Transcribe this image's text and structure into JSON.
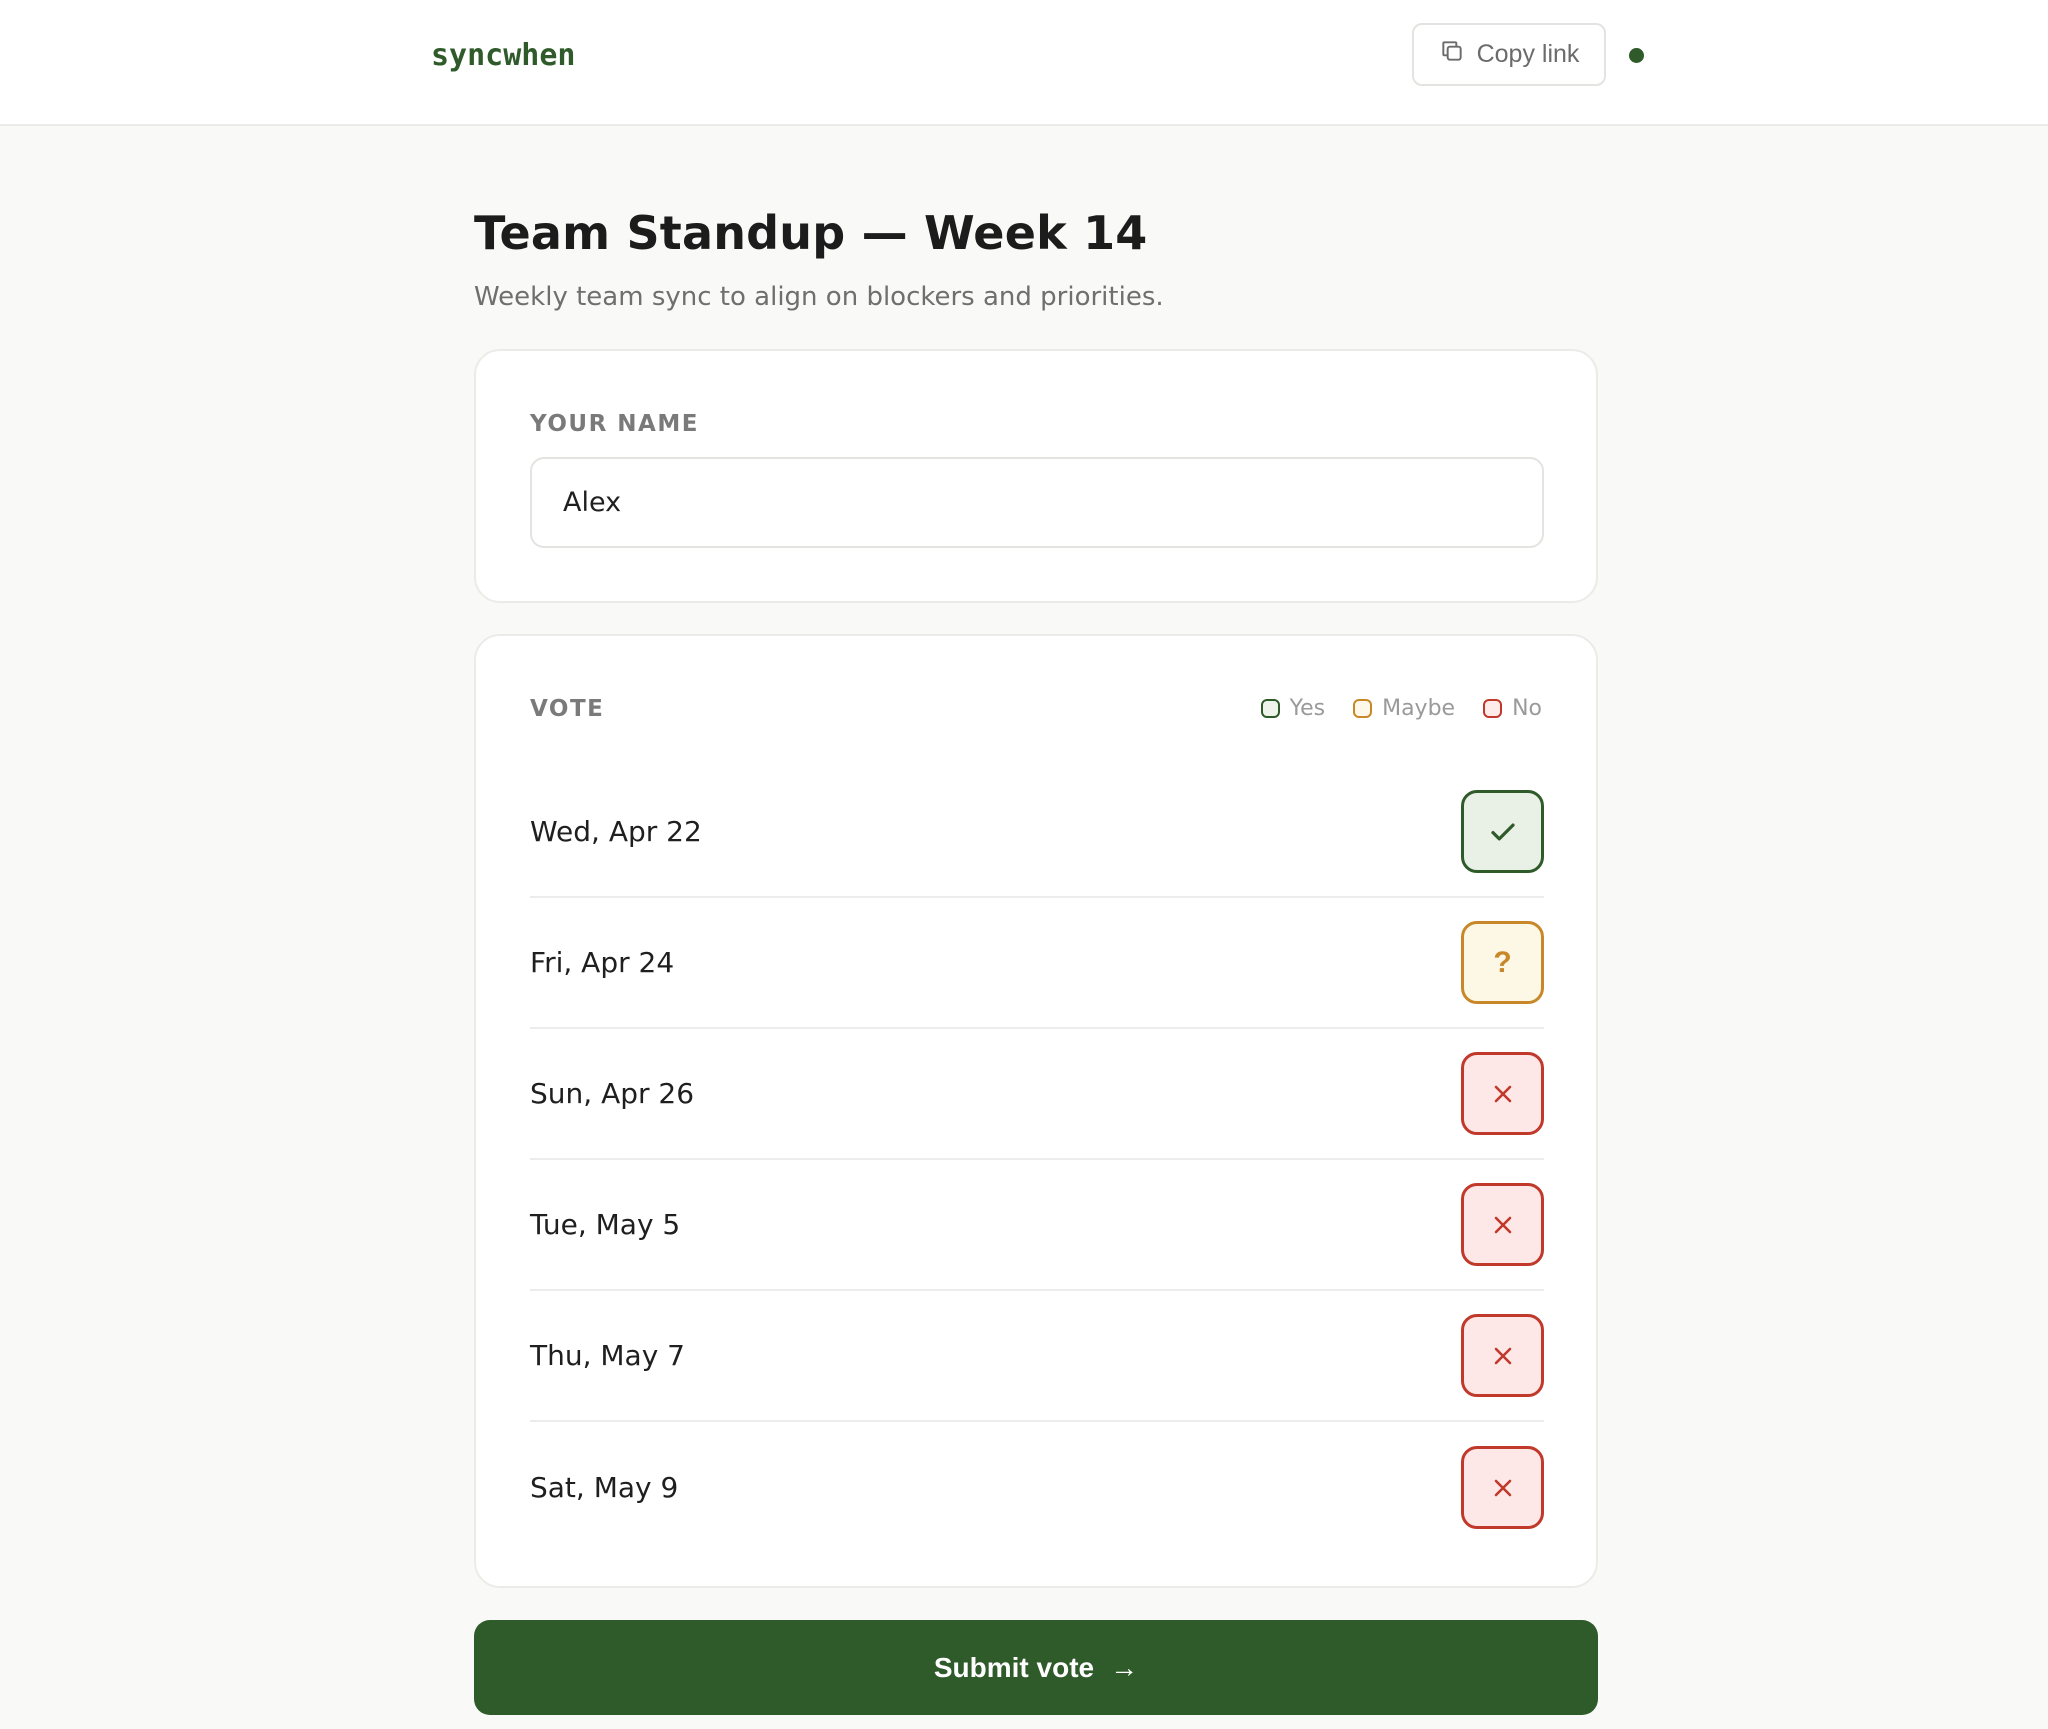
{
  "header": {
    "logo": "syncwhen",
    "copy_label": "Copy link"
  },
  "poll": {
    "title": "Team Standup — Week 14",
    "description": "Weekly team sync to align on blockers and priorities."
  },
  "name_section": {
    "label": "YOUR NAME",
    "value": "Alex"
  },
  "vote_section": {
    "label": "VOTE",
    "legend": [
      {
        "key": "yes",
        "label": "Yes"
      },
      {
        "key": "maybe",
        "label": "Maybe"
      },
      {
        "key": "no",
        "label": "No"
      }
    ],
    "rows": [
      {
        "date": "Wed, Apr 22",
        "vote": "yes"
      },
      {
        "date": "Fri, Apr 24",
        "vote": "maybe"
      },
      {
        "date": "Sun, Apr 26",
        "vote": "no"
      },
      {
        "date": "Tue, May 5",
        "vote": "no"
      },
      {
        "date": "Thu, May 7",
        "vote": "no"
      },
      {
        "date": "Sat, May 9",
        "vote": "no"
      }
    ]
  },
  "submit": {
    "label": "Submit vote",
    "arrow": "→"
  },
  "colors": {
    "brand": "#2f5a2a",
    "yes": "#2f5a2a",
    "maybe": "#c8882a",
    "no": "#c0392b"
  }
}
